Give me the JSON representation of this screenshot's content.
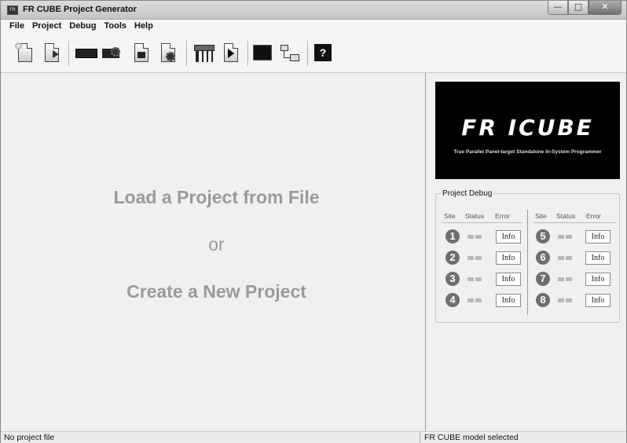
{
  "window": {
    "title": "FR CUBE Project Generator",
    "icon_label": "FR",
    "controls": {
      "minimize": "—",
      "maximize": "□",
      "close": "✕"
    }
  },
  "menu": [
    "File",
    "Project",
    "Debug",
    "Tools",
    "Help"
  ],
  "toolbar": {
    "icons": [
      "new-project-icon",
      "open-project-icon",
      "chip-icon",
      "chip-settings-icon",
      "document-settings-icon",
      "document-gear-icon",
      "socket-icon",
      "run-icon",
      "terminal-icon",
      "transfer-icon",
      "help-icon"
    ],
    "help_glyph": "?"
  },
  "main": {
    "line1": "Load a Project from File",
    "line2": "or",
    "line3": "Create a New Project"
  },
  "logo": {
    "wordmark": "FR ICUBE",
    "tagline": "True Parallel Panel-target Standalone In-System Programmer"
  },
  "debug": {
    "title": "Project Debug",
    "headers": {
      "site": "Site",
      "status": "Status",
      "error": "Error"
    },
    "info_label": "Info",
    "sites": [
      "1",
      "2",
      "3",
      "4",
      "5",
      "6",
      "7",
      "8"
    ]
  },
  "statusbar": {
    "left": "No project file",
    "right": "FR CUBE model selected"
  },
  "colors": {
    "chrome": "#f0f0f0",
    "placeholder_text": "#9a9a9a",
    "site_circle": "#6e6e6e",
    "logo_bg": "#000000"
  }
}
